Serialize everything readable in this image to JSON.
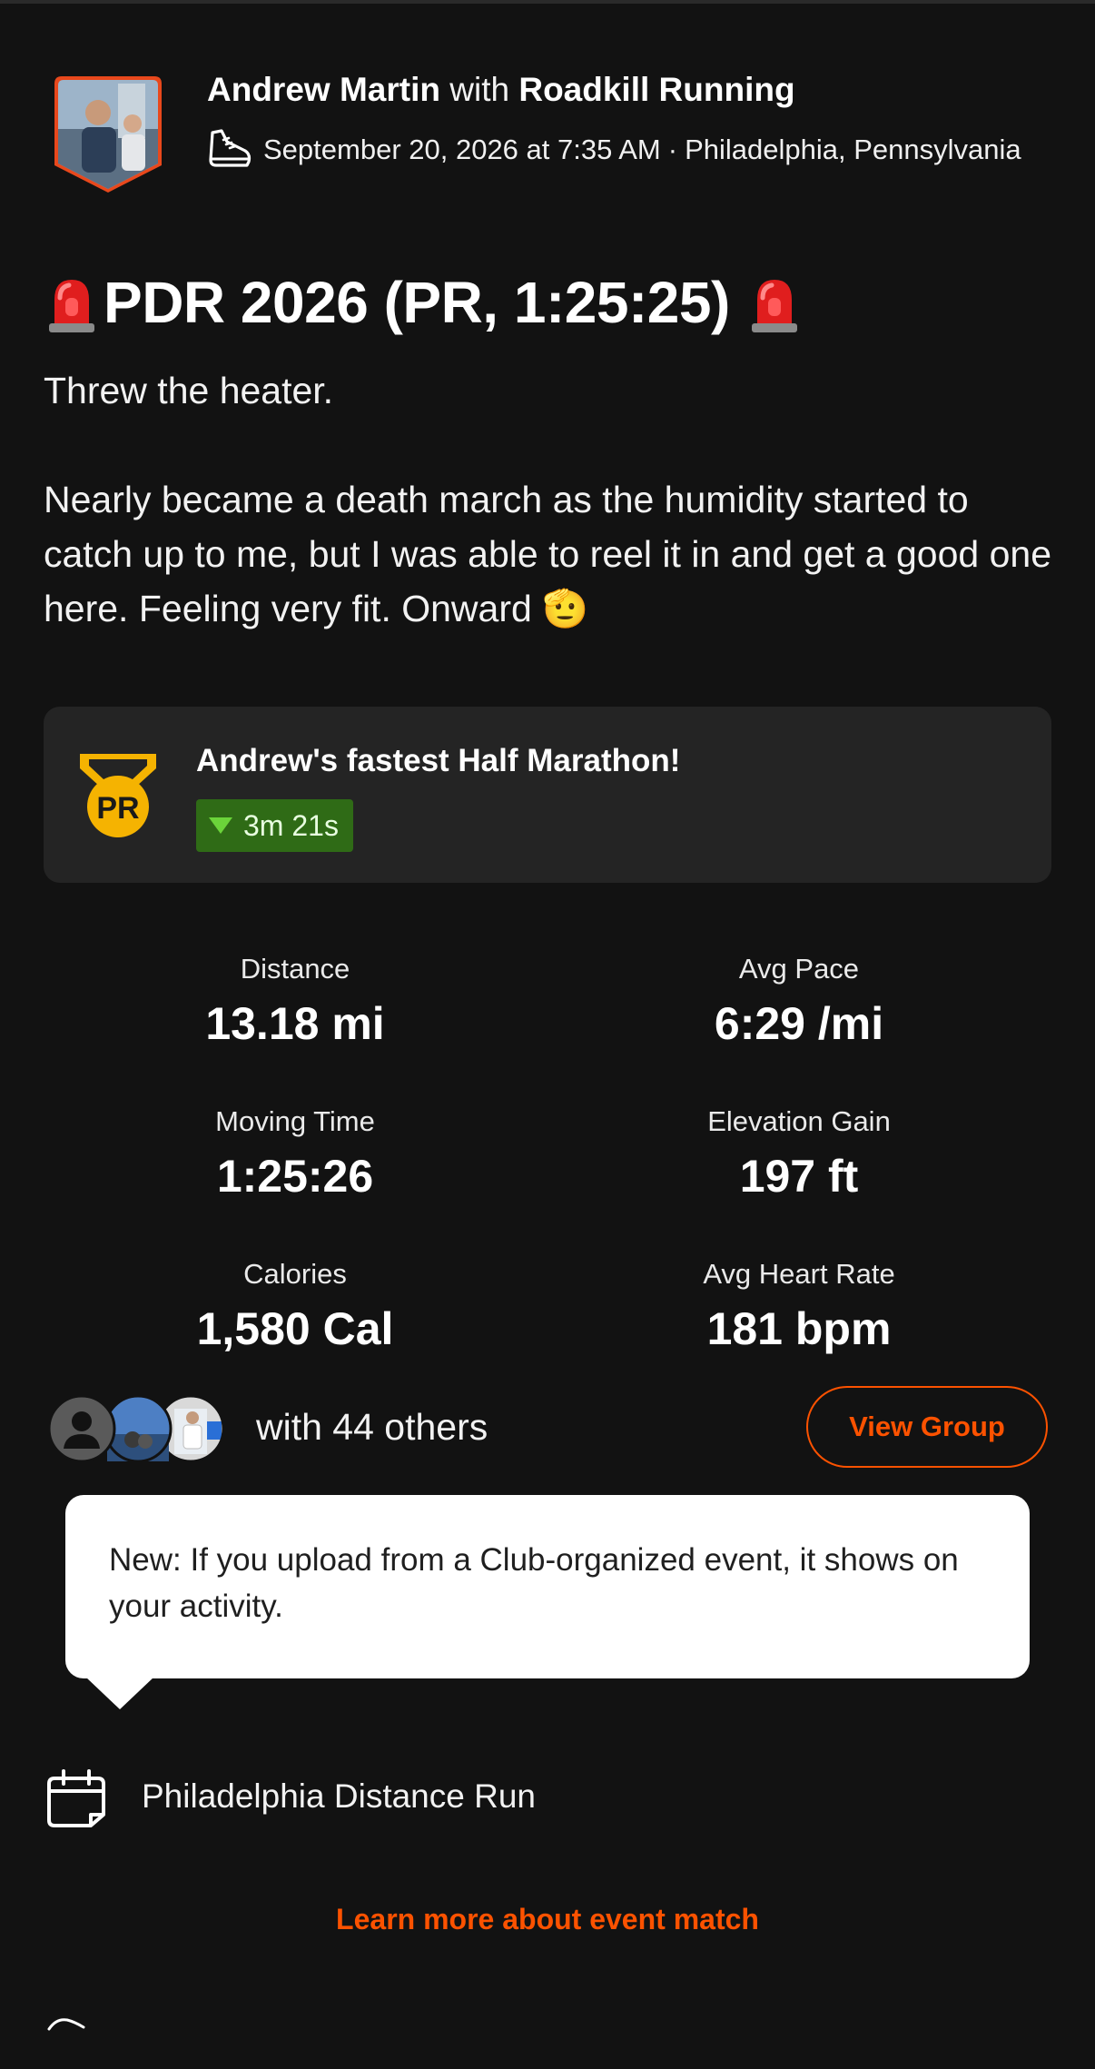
{
  "header": {
    "athlete_name": "Andrew Martin",
    "with_word": "with",
    "club_name": "Roadkill Running",
    "date_time": "September 20, 2026 at 7:35 AM",
    "separator": "·",
    "location": "Philadelphia, Pennsylvania",
    "activity_icon": "running-shoe-icon"
  },
  "activity": {
    "title": "PDR 2026 (PR, 1:25:25)",
    "title_emoji": "police-siren-icon",
    "description_lines": [
      "Threw the heater.",
      "Nearly became a death march as the humidity started to catch up to me, but I was able to reel it in and get a good one here. Feeling very fit. Onward 🫡"
    ]
  },
  "pr_card": {
    "title": "Andrew's fastest Half Marathon!",
    "medal_text": "PR",
    "improvement": "3m 21s",
    "colors": {
      "medal": "#f5b301",
      "badge_bg": "#2f6b16",
      "badge_arrow": "#6bd43a"
    }
  },
  "stats": [
    {
      "label": "Distance",
      "value": "13.18 mi"
    },
    {
      "label": "Avg Pace",
      "value": "6:29 /mi"
    },
    {
      "label": "Moving Time",
      "value": "1:25:26"
    },
    {
      "label": "Elevation Gain",
      "value": "197 ft"
    },
    {
      "label": "Calories",
      "value": "1,580 Cal"
    },
    {
      "label": "Avg Heart Rate",
      "value": "181 bpm"
    }
  ],
  "group": {
    "others_text": "with 44 others",
    "view_group_label": "View Group"
  },
  "tooltip": {
    "text": "New: If you upload from a Club-organized event, it shows on your activity."
  },
  "event": {
    "name": "Philadelphia Distance Run",
    "icon": "calendar-icon",
    "learn_more": "Learn more about event match"
  },
  "colors": {
    "background": "#121212",
    "accent": "#fc5200",
    "card": "#242424"
  }
}
